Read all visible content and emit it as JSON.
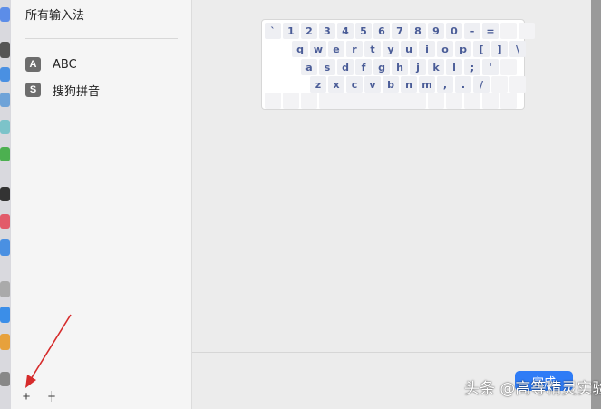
{
  "sidebar": {
    "title": "所有输入法",
    "items": [
      {
        "icon_glyph": "A",
        "icon": "abc-input-icon",
        "label": "ABC"
      },
      {
        "icon_glyph": "S",
        "icon": "sogou-pinyin-icon",
        "label": "搜狗拼音"
      }
    ],
    "add_label": "+",
    "remove_label": "−"
  },
  "keyboard": {
    "rows": [
      [
        "`",
        "1",
        "2",
        "3",
        "4",
        "5",
        "6",
        "7",
        "8",
        "9",
        "0",
        "-",
        "="
      ],
      [
        "q",
        "w",
        "e",
        "r",
        "t",
        "y",
        "u",
        "i",
        "o",
        "p",
        "[",
        "]",
        "\\"
      ],
      [
        "a",
        "s",
        "d",
        "f",
        "g",
        "h",
        "j",
        "k",
        "l",
        ";",
        "'"
      ],
      [
        "z",
        "x",
        "c",
        "v",
        "b",
        "n",
        "m",
        ",",
        ".",
        "/"
      ]
    ]
  },
  "footer": {
    "done_label": "完成"
  },
  "watermark": "头条 @高等精灵实验室",
  "colors": {
    "key_text": "#4a5c97",
    "key_bg": "#eeeff3",
    "accent": "#2f7cf6",
    "annotation_arrow": "#d62b2b"
  }
}
